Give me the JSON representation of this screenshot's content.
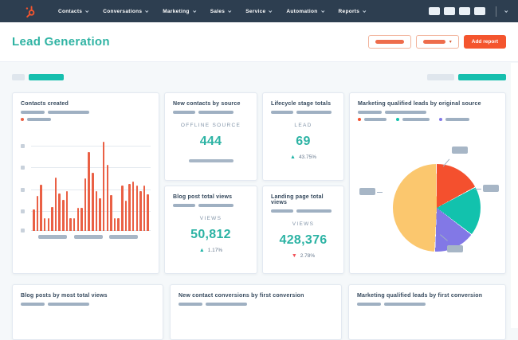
{
  "nav": {
    "items": [
      {
        "label": "Contacts"
      },
      {
        "label": "Conversations"
      },
      {
        "label": "Marketing"
      },
      {
        "label": "Sales"
      },
      {
        "label": "Service"
      },
      {
        "label": "Automation"
      },
      {
        "label": "Reports"
      }
    ],
    "icon_placeholder_count": 4
  },
  "header": {
    "title": "Lead Generation",
    "add_report_label": "Add report"
  },
  "glyphs": {
    "triangle_up": "▲",
    "triangle_down": "▼",
    "caret_down": "▾"
  },
  "icons": {
    "logo": "hubspot-sprocket-icon",
    "nav_item_caret": "chevron-down-icon",
    "filter_caret": "triangle-down-icon",
    "delta_up": "triangle-up-icon",
    "delta_down": "triangle-down-icon"
  },
  "colors": {
    "nav_bg": "#2d3e50",
    "accent_teal": "#2cb3a4",
    "accent_orange": "#f4552e",
    "chart_bar_orange": "#ea6045",
    "delta_up_teal": "#1db3a6",
    "delta_down_red": "#f2545b",
    "placeholder_gray": "#9fb0c2",
    "tab_teal": "#17bfae"
  },
  "cards": {
    "contacts_created": {
      "title": "Contacts created"
    },
    "new_contacts_by_source": {
      "title": "New contacts by source",
      "metric_label": "OFFLINE SOURCE",
      "value": "444"
    },
    "lifecycle_stage_totals": {
      "title": "Lifecycle stage totals",
      "metric_label": "LEAD",
      "value": "69",
      "delta": "43.75%",
      "delta_direction": "up"
    },
    "blog_post_total_views": {
      "title": "Blog post total views",
      "metric_label": "VIEWS",
      "value": "50,812",
      "delta": "1.17%",
      "delta_direction": "up"
    },
    "landing_page_total_views": {
      "title": "Landing page total views",
      "metric_label": "VIEWS",
      "value": "428,376",
      "delta": "2.78%",
      "delta_direction": "down"
    },
    "mql_by_original_source": {
      "title": "Marketing qualified leads by original source"
    },
    "blog_posts_by_most_total_views": {
      "title": "Blog posts by most total views"
    },
    "new_contact_conversions_by_first_conversion": {
      "title": "New contact conversions by first conversion"
    },
    "mql_by_first_conversion": {
      "title": "Marketing qualified leads by first conversion"
    }
  },
  "chart_data": [
    {
      "type": "bar",
      "title": "Contacts created",
      "bar_color": "#ea6045",
      "values": [
        24,
        39,
        52,
        14,
        14,
        27,
        60,
        42,
        35,
        45,
        14,
        14,
        26,
        26,
        59,
        88,
        65,
        45,
        37,
        100,
        74,
        40,
        14,
        14,
        51,
        34,
        53,
        55,
        51,
        45,
        51,
        41
      ],
      "ylim": [
        0,
        100
      ],
      "grid": true,
      "y_tick_placeholder_count": 5,
      "x_tick_placeholder_count": 3,
      "legend_placeholder_count": 1
    },
    {
      "type": "pie",
      "title": "Marketing qualified leads by original source",
      "start_angle_deg": 0,
      "slices": [
        {
          "name": "slice-1",
          "percent": 17,
          "color": "#f4502e"
        },
        {
          "name": "slice-2",
          "percent": 18,
          "color": "#12c2ad"
        },
        {
          "name": "slice-3",
          "percent": 15,
          "color": "#8278e6"
        },
        {
          "name": "slice-4",
          "percent": 50,
          "color": "#fbc76e"
        }
      ],
      "legend_placeholder_count": 3,
      "callout_placeholder_count": 4
    }
  ]
}
